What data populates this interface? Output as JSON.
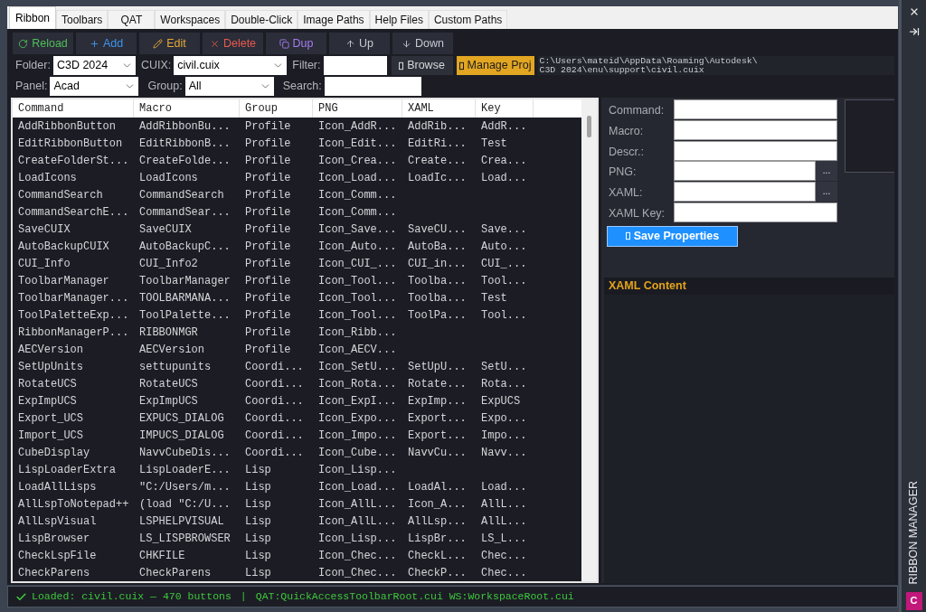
{
  "tabs": [
    {
      "label": "Ribbon",
      "selected": true
    },
    {
      "label": "Toolbars",
      "selected": false
    },
    {
      "label": "QAT",
      "selected": false
    },
    {
      "label": "Workspaces",
      "selected": false
    },
    {
      "label": "Double-Click",
      "selected": false
    },
    {
      "label": "Image Paths",
      "selected": false
    },
    {
      "label": "Help Files",
      "selected": false
    },
    {
      "label": "Custom Paths",
      "selected": false
    }
  ],
  "toolbar": [
    {
      "kind": "reload",
      "label": "Reload"
    },
    {
      "kind": "add",
      "label": "Add"
    },
    {
      "kind": "edit",
      "label": "Edit"
    },
    {
      "kind": "delete",
      "label": "Delete"
    },
    {
      "kind": "dup",
      "label": "Dup"
    },
    {
      "kind": "up",
      "label": "Up"
    },
    {
      "kind": "down",
      "label": "Down"
    }
  ],
  "source_bar": {
    "folder": {
      "label": "Folder:",
      "value": "C3D 2024"
    },
    "cuix": {
      "label": "CUIX:",
      "value": "civil.cuix"
    },
    "filter": {
      "label": "Filter:"
    },
    "browse_button": "Browse",
    "manage_button": "Manage Proj",
    "path": "C:\\Users\\mateid\\AppData\\Roaming\\Autodesk\\C3D 2024\\enu\\support\\civil.cuix"
  },
  "filter_bar": {
    "panel": {
      "label": "Panel:",
      "value": "Acad"
    },
    "group": {
      "label": "Group:",
      "value": "All"
    },
    "search": {
      "label": "Search:"
    }
  },
  "table": {
    "columns": [
      "Command",
      "Macro",
      "Group",
      "PNG",
      "XAML",
      "Key"
    ],
    "rows": [
      {
        "command": "AddRibbonButton",
        "macro": "AddRibbonBu...",
        "group": "Profile",
        "png": "Icon_AddR...",
        "xaml": "AddRib...",
        "key": "AddR..."
      },
      {
        "command": "EditRibbonButton",
        "macro": "EditRibbonB...",
        "group": "Profile",
        "png": "Icon_Edit...",
        "xaml": "EditRi...",
        "key": "Test"
      },
      {
        "command": "CreateFolderSt...",
        "macro": "CreateFolde...",
        "group": "Profile",
        "png": "Icon_Crea...",
        "xaml": "Create...",
        "key": "Crea..."
      },
      {
        "command": "LoadIcons",
        "macro": "LoadIcons",
        "group": "Profile",
        "png": "Icon_Load...",
        "xaml": "LoadIc...",
        "key": "Load..."
      },
      {
        "command": "CommandSearch",
        "macro": "CommandSearch",
        "group": "Profile",
        "png": "Icon_Comm..."
      },
      {
        "command": "CommandSearchE...",
        "macro": "CommandSear...",
        "group": "Profile",
        "png": "Icon_Comm..."
      },
      {
        "command": "SaveCUIX",
        "macro": "SaveCUIX",
        "group": "Profile",
        "png": "Icon_Save...",
        "xaml": "SaveCU...",
        "key": "Save..."
      },
      {
        "command": "AutoBackupCUIX",
        "macro": "AutoBackupC...",
        "group": "Profile",
        "png": "Icon_Auto...",
        "xaml": "AutoBa...",
        "key": "Auto..."
      },
      {
        "command": "CUI_Info",
        "macro": "CUI_Info2",
        "group": "Profile",
        "png": "Icon_CUI_...",
        "xaml": "CUI_in...",
        "key": "CUI_..."
      },
      {
        "command": "ToolbarManager",
        "macro": "ToolbarManager",
        "group": "Profile",
        "png": "Icon_Tool...",
        "xaml": "Toolba...",
        "key": "Tool..."
      },
      {
        "command": "ToolbarManager...",
        "macro": "TOOLBARMANA...",
        "group": "Profile",
        "png": "Icon_Tool...",
        "xaml": "Toolba...",
        "key": "Test"
      },
      {
        "command": "ToolPaletteExp...",
        "macro": "ToolPalette...",
        "group": "Profile",
        "png": "Icon_Tool...",
        "xaml": "ToolPa...",
        "key": "Tool..."
      },
      {
        "command": "RibbonManagerP...",
        "macro": "RIBBONMGR",
        "group": "Profile",
        "png": "Icon_Ribb..."
      },
      {
        "command": "AECVersion",
        "macro": "AECVersion",
        "group": "Profile",
        "png": "Icon_AECV..."
      },
      {
        "command": "SetUpUnits",
        "macro": "settupunits",
        "group": "Coordi...",
        "png": "Icon_SetU...",
        "xaml": "SetUpU...",
        "key": "SetU..."
      },
      {
        "command": "RotateUCS",
        "macro": "RotateUCS",
        "group": "Coordi...",
        "png": "Icon_Rota...",
        "xaml": "Rotate...",
        "key": "Rota..."
      },
      {
        "command": "ExpImpUCS",
        "macro": "ExpImpUCS",
        "group": "Coordi...",
        "png": "Icon_ExpI...",
        "xaml": "ExpImp...",
        "key": "ExpUCS"
      },
      {
        "command": "Export_UCS",
        "macro": "EXPUCS_DIALOG",
        "group": "Coordi...",
        "png": "Icon_Expo...",
        "xaml": "Export...",
        "key": "Expo..."
      },
      {
        "command": "Import_UCS",
        "macro": "IMPUCS_DIALOG",
        "group": "Coordi...",
        "png": "Icon_Impo...",
        "xaml": "Export...",
        "key": "Impo..."
      },
      {
        "command": "CubeDisplay",
        "macro": "NavvCubeDis...",
        "group": "Coordi...",
        "png": "Icon_Cube...",
        "xaml": "NavvCu...",
        "key": "Navv..."
      },
      {
        "command": "LispLoaderExtra",
        "macro": "LispLoaderE...",
        "group": "Lisp",
        "png": "Icon_Lisp..."
      },
      {
        "command": "LoadAllLisps",
        "macro": "\"C:/Users/m...",
        "group": "Lisp",
        "png": "Icon_Load...",
        "xaml": "LoadAl...",
        "key": "Load..."
      },
      {
        "command": "AllLspToNotepad++",
        "macro": "(load \"C:/U...",
        "group": "Lisp",
        "png": "Icon_AllL...",
        "xaml": "Icon_A...",
        "key": "AllL..."
      },
      {
        "command": "AllLspVisual",
        "macro": "LSPHELPVISUAL",
        "group": "Lisp",
        "png": "Icon_AllL...",
        "xaml": "AllLsp...",
        "key": "AllL..."
      },
      {
        "command": "LispBrowser",
        "macro": "LS_LISPBROWSER",
        "group": "Lisp",
        "png": "Icon_Lisp...",
        "xaml": "LispBr...",
        "key": "LS_L..."
      },
      {
        "command": "CheckLspFile",
        "macro": "CHKFILE",
        "group": "Lisp",
        "png": "Icon_Chec...",
        "xaml": "CheckL...",
        "key": "Chec..."
      },
      {
        "command": "CheckParens",
        "macro": "CheckParens",
        "group": "Lisp",
        "png": "Icon_Chec...",
        "xaml": "CheckP...",
        "key": "Chec..."
      }
    ]
  },
  "properties": {
    "fields": [
      {
        "label": "Command:",
        "kind": "text"
      },
      {
        "label": "Macro:",
        "kind": "text"
      },
      {
        "label": "Descr.:",
        "kind": "text"
      },
      {
        "label": "PNG:",
        "kind": "file",
        "button": "..."
      },
      {
        "label": "XAML:",
        "kind": "file",
        "button": "..."
      },
      {
        "label": "XAML Key:",
        "kind": "text"
      }
    ],
    "save_button": "Save Properties"
  },
  "xaml_content": {
    "title": "XAML Content"
  },
  "status_bar": {
    "kind": "success",
    "message": "Loaded: civil.cuix — 470 buttons",
    "separator": "|",
    "details": "QAT:QuickAccessToolbarRoot.cui WS:WorkspaceRoot.cui"
  },
  "side_panel": {
    "title": "RIBBON MANAGER",
    "app_badge": "C"
  }
}
